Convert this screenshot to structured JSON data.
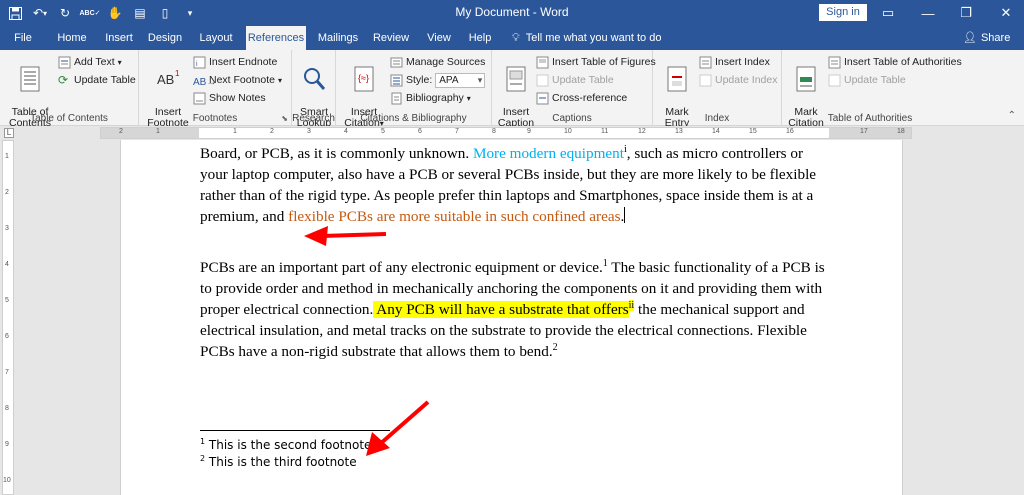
{
  "window": {
    "title": "My Document  -  Word",
    "sign_in": "Sign in"
  },
  "ribbon_tabs": [
    "File",
    "Home",
    "Insert",
    "Design",
    "Layout",
    "References",
    "Mailings",
    "Review",
    "View",
    "Help"
  ],
  "active_tab": "References",
  "tell_me": "Tell me what you want to do",
  "share": "Share",
  "groups": {
    "toc": {
      "label": "Table of Contents",
      "table_of_contents": "Table of\nContents",
      "add_text": "Add Text",
      "update_table": "Update Table"
    },
    "footnotes": {
      "label": "Footnotes",
      "insert_footnote": "Insert\nFootnote",
      "ab_icon_text": "AB",
      "insert_endnote": "Insert Endnote",
      "next_footnote": "Next Footnote",
      "show_notes": "Show Notes"
    },
    "research": {
      "label": "Research",
      "smart_lookup": "Smart\nLookup"
    },
    "citations": {
      "label": "Citations & Bibliography",
      "insert_citation": "Insert\nCitation",
      "manage_sources": "Manage Sources",
      "style_label": "Style:",
      "style_value": "APA",
      "bibliography": "Bibliography"
    },
    "captions": {
      "label": "Captions",
      "insert_caption": "Insert\nCaption",
      "insert_table_of_figures": "Insert Table of Figures",
      "update_table": "Update Table",
      "cross_reference": "Cross-reference"
    },
    "index": {
      "label": "Index",
      "mark_entry": "Mark\nEntry",
      "insert_index": "Insert Index",
      "update_index": "Update Index"
    },
    "toa": {
      "label": "Table of Authorities",
      "mark_citation": "Mark\nCitation",
      "insert_toa": "Insert Table of Authorities",
      "update_table": "Update Table"
    }
  },
  "ruler": {
    "numbers": [
      "2",
      "1",
      "1",
      "2",
      "3",
      "4",
      "5",
      "6",
      "7",
      "8",
      "9",
      "10",
      "11",
      "12",
      "13",
      "14",
      "15",
      "16",
      "17",
      "18"
    ],
    "vertical_numbers": [
      "1",
      "2",
      "3",
      "4",
      "5",
      "6",
      "7",
      "8",
      "9",
      "10"
    ]
  },
  "document": {
    "p1": {
      "a": "Board, or PCB, as it is commonly unknown. ",
      "b_blue": "More modern equipment",
      "b_sup": "i",
      "c": ", such as micro controllers or your laptop computer, also have a PCB or several PCBs inside, but they are more likely to be flexible rather than of the rigid type. As people prefer thin laptops and Smartphones, space inside them is at a premium, and ",
      "d_orange": "flexible PCBs are more suitable in such confined areas",
      "e": "."
    },
    "p2": {
      "a": "PCBs are an important part of any electronic equipment or device.",
      "a_sup": "1",
      "b": " The basic functionality of a PCB is to provide order and method in mechanically anchoring the components on it and providing them with proper electrical connection.",
      "c_hl": " Any PCB will have a substrate that offers",
      "c_sup": "ii",
      "d": " the mechanical support and electrical insulation, and metal tracks on the substrate to provide the electrical connections. Flexible PCBs have a non-rigid substrate that allows them to bend.",
      "d_sup": "2"
    },
    "footnotes": [
      {
        "num": "1",
        "text": " This is the second footnote"
      },
      {
        "num": "2",
        "text": " This is the third footnote"
      }
    ]
  },
  "colors": {
    "word_blue": "#2b579a",
    "link_blue": "#00b0f0",
    "orange": "#c55a11",
    "highlight": "#ffff00",
    "arrow_red": "#ff0000"
  }
}
